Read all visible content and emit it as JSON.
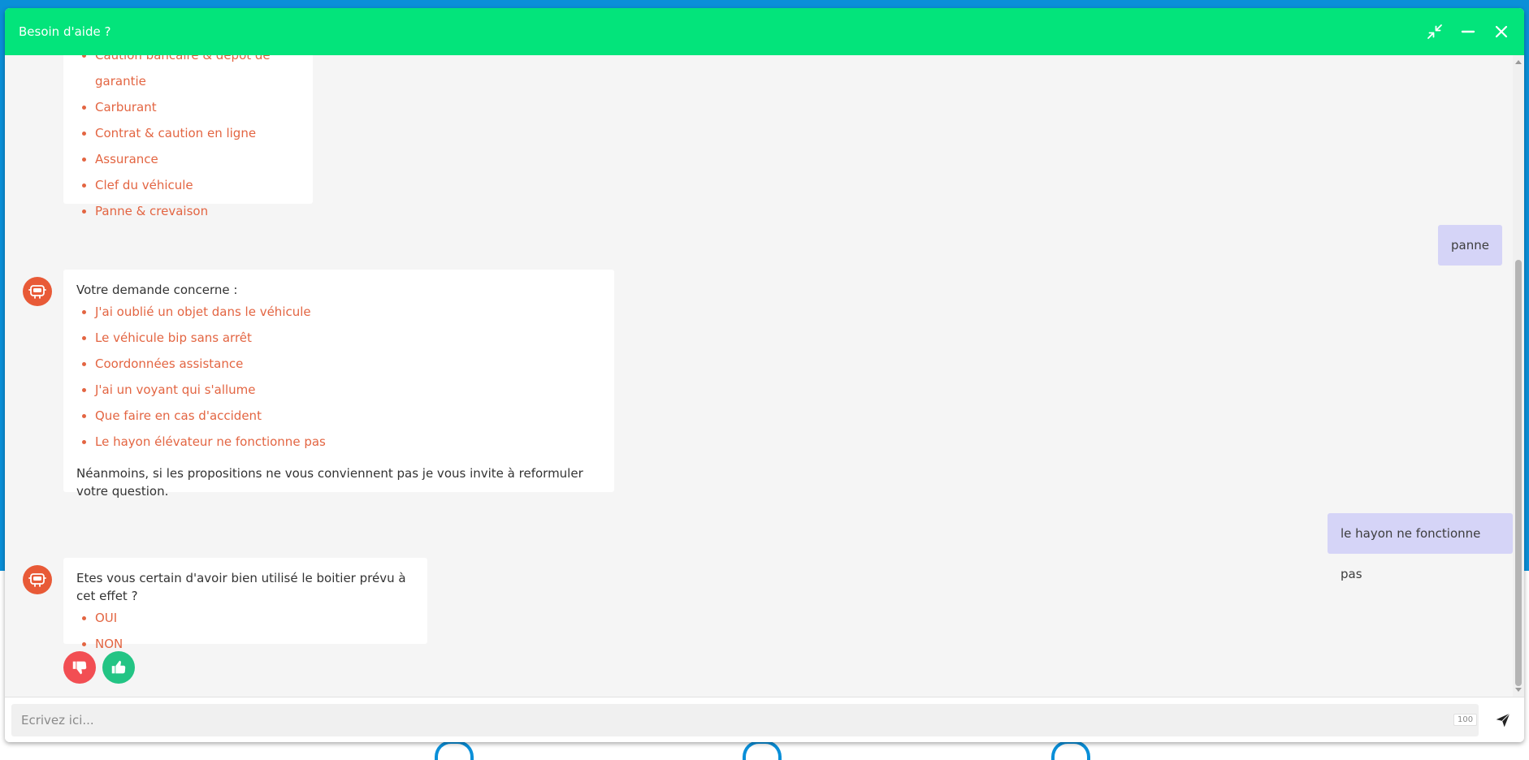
{
  "header": {
    "title": "Besoin d'aide ?"
  },
  "messages": {
    "bot_1": {
      "items": [
        "Caution bancaire & dépôt de garantie",
        "Carburant",
        "Contrat & caution en ligne",
        "Assurance",
        "Clef du véhicule",
        "Panne & crevaison"
      ]
    },
    "user_1": {
      "text": "panne"
    },
    "bot_2": {
      "intro": "Votre demande concerne :",
      "items": [
        "J'ai oublié un objet dans le véhicule",
        "Le véhicule bip sans arrêt",
        "Coordonnées assistance",
        "J'ai un voyant qui s'allume",
        "Que faire en cas d'accident",
        "Le hayon élévateur ne fonctionne pas"
      ],
      "outro": "Néanmoins, si les propositions ne vous conviennent pas je vous invite à reformuler votre question."
    },
    "user_2": {
      "text": "le hayon ne fonctionne pas"
    },
    "bot_3": {
      "intro": "Etes vous certain d'avoir bien utilisé le boitier prévu à cet effet ?",
      "items": [
        "OUI",
        "NON"
      ]
    }
  },
  "input": {
    "placeholder": "Ecrivez ici...",
    "char_count": "100"
  },
  "colors": {
    "header": "#03e47b",
    "link": "#e36542",
    "user_bubble": "#d5d4f7",
    "avatar": "#e85a37",
    "thumbs_down": "#f24e53",
    "thumbs_up": "#23c484"
  },
  "icons": {
    "header": [
      "collapse-icon",
      "minimize-icon",
      "close-icon"
    ],
    "bot_avatar": "robot-icon",
    "feedback": [
      "thumbs-down-icon",
      "thumbs-up-icon"
    ],
    "send": "send-icon"
  }
}
